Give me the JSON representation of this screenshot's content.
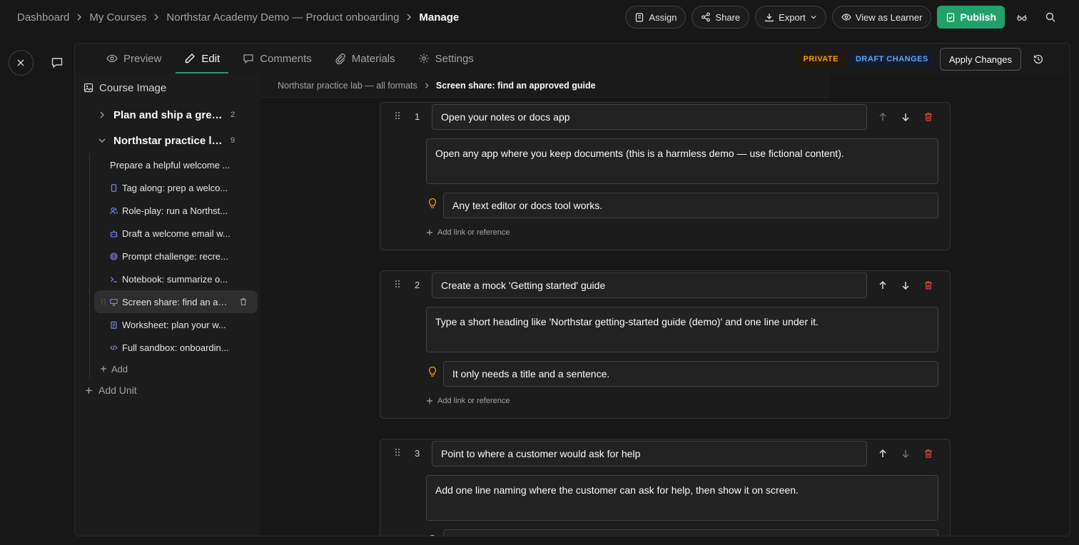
{
  "breadcrumbs": [
    "Dashboard",
    "My Courses",
    "Northstar Academy Demo — Product onboarding",
    "Manage"
  ],
  "topbar": {
    "assign": "Assign",
    "share": "Share",
    "export": "Export",
    "view_as_learner": "View as Learner",
    "publish": "Publish"
  },
  "tabs": [
    "Preview",
    "Edit",
    "Comments",
    "Materials",
    "Settings"
  ],
  "active_tab": "Edit",
  "badges": {
    "private": "PRIVATE",
    "draft": "DRAFT CHANGES"
  },
  "apply_changes": "Apply Changes",
  "sidebar": {
    "header": "Course Image",
    "units": [
      {
        "title": "Plan and ship a great ...",
        "count": "2",
        "expanded": false
      },
      {
        "title": "Northstar practice lab ...",
        "count": "9",
        "expanded": true
      }
    ],
    "lessons": [
      {
        "label": "Prepare a helpful welcome ...",
        "icon": "none"
      },
      {
        "label": "Tag along: prep a welco...",
        "icon": "phone-icon"
      },
      {
        "label": "Role-play: run a Northst...",
        "icon": "users-icon"
      },
      {
        "label": "Draft a welcome email w...",
        "icon": "robot-icon"
      },
      {
        "label": "Prompt challenge: recre...",
        "icon": "target-icon"
      },
      {
        "label": "Notebook: summarize o...",
        "icon": "terminal-icon"
      },
      {
        "label": "Screen share: find an ap...",
        "icon": "monitor-icon",
        "selected": true
      },
      {
        "label": "Worksheet: plan your w...",
        "icon": "clipboard-icon"
      },
      {
        "label": "Full sandbox: onboardin...",
        "icon": "code-icon"
      }
    ],
    "add": "Add",
    "add_unit": "Add Unit"
  },
  "content_breadcrumb": {
    "parent": "Northstar practice lab — all formats",
    "current": "Screen share: find an approved guide"
  },
  "steps": [
    {
      "number": "1",
      "title": "Open your notes or docs app",
      "description": "Open any app where you keep documents (this is a harmless demo — use fictional content).",
      "tip": "Any text editor or docs tool works.",
      "add_ref": "Add link or reference"
    },
    {
      "number": "2",
      "title": "Create a mock 'Getting started' guide",
      "description": "Type a short heading like 'Northstar getting-started guide (demo)' and one line under it.",
      "tip": "It only needs a title and a sentence.",
      "add_ref": "Add link or reference"
    },
    {
      "number": "3",
      "title": "Point to where a customer would ask for help",
      "description": "Add one line naming where the customer can ask for help, then show it on screen.",
      "tip": "",
      "add_ref": ""
    }
  ],
  "colors": {
    "accent": "#22a06b",
    "private": "#f59e0b",
    "draft": "#60a5fa",
    "danger": "#ef4444",
    "lesson_icon": "#818cf8"
  }
}
